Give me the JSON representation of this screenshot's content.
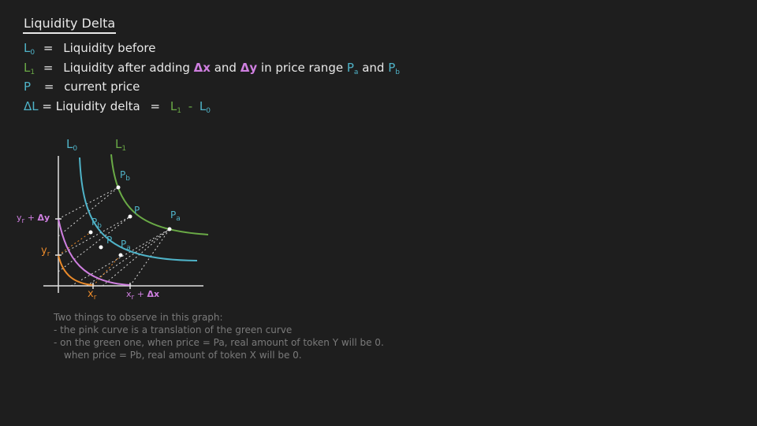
{
  "title": "Liquidity Delta",
  "defs": {
    "l0": {
      "sym": "L",
      "sub": "0",
      "eq": "=",
      "text": "Liquidity before"
    },
    "l1": {
      "sym": "L",
      "sub": "1",
      "eq": "=",
      "text_a": "Liquidity after adding",
      "dx": "Δx",
      "and1": "and",
      "dy": "Δy",
      "text_b": "in price range",
      "pa": "P",
      "pa_sub": "a",
      "and2": "and",
      "pb": "P",
      "pb_sub": "b"
    },
    "p": {
      "sym": "P",
      "eq": "=",
      "text": "current price"
    },
    "dl": {
      "sym": "ΔL",
      "eq": "=",
      "text": "Liquidity delta",
      "eq2": "=",
      "l1": "L",
      "l1_sub": "1",
      "minus": "-",
      "l0": "L",
      "l0_sub": "0"
    }
  },
  "graph": {
    "curve_l0_label": "L",
    "curve_l0_sub": "0",
    "curve_l1_label": "L",
    "curve_l1_sub": "1",
    "label_pb_green": "P",
    "label_pb_green_sub": "b",
    "label_p_green": "P",
    "label_pa_green": "P",
    "label_pa_green_sub": "a",
    "label_pb_blue": "P",
    "label_pb_blue_sub": "b",
    "label_p_blue": "P",
    "label_pa_blue": "P",
    "label_pa_blue_sub": "a",
    "y_top_label": "y",
    "y_top_sub": "r",
    "y_top_plus": "+",
    "y_top_delta": "Δy",
    "y_mid_label": "y",
    "y_mid_sub": "r",
    "x_left_label": "x",
    "x_left_sub": "r",
    "x_right_label": "x",
    "x_right_sub": "r",
    "x_right_plus": "+",
    "x_right_delta": "Δx",
    "colors": {
      "blue": "#4fb3c8",
      "green": "#6aaa46",
      "pink": "#cf7fe0",
      "orange": "#ea8a2a",
      "dotted": "#d8d8d8"
    }
  },
  "notes": {
    "line1": "Two things to observe in this graph:",
    "line2": "- the pink curve is a translation of the green curve",
    "line3": "- on the green one, when price = Pa, real amount of token Y will be 0.",
    "line4": "when price = Pb, real amount of token X will be 0."
  }
}
